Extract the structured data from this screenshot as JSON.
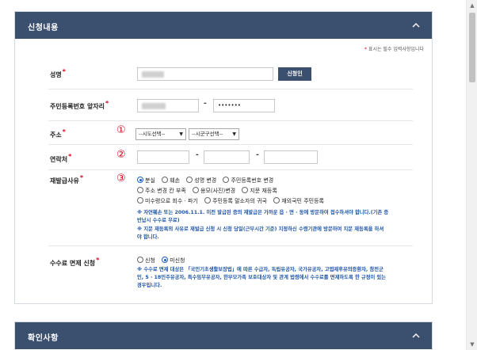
{
  "section1": {
    "title": "신청내용",
    "required_note": "표시는 필수 입력사항입니다",
    "required_mark": "*"
  },
  "fields": {
    "name": {
      "label": "성명",
      "button": "신청인"
    },
    "rrn": {
      "label": "주민등록번호 앞자리",
      "separator": "-",
      "back_value": "•••••••"
    },
    "address": {
      "label": "주소",
      "marker": "①",
      "sido": "--시도선택--",
      "sigungu": "--시군구선택--"
    },
    "contact": {
      "label": "연락처",
      "marker": "②",
      "sep1": "-",
      "sep2": "-"
    },
    "reason": {
      "label": "재발급사유",
      "marker": "③",
      "options_row1": [
        "분실",
        "훼손",
        "성명 변경",
        "주민등록번호 변경"
      ],
      "options_row2": [
        "주소 변경 칸 부족",
        "용모(사진)변경",
        "지문 재등록"
      ],
      "options_row3": [
        "미수령으로 회수 · 파기",
        "주민등록 말소자의 귀국",
        "재외국민 주민등록"
      ],
      "selected": "분실",
      "notice1_line1": "※ 자연훼손 또는 2006.11.1. 이전 발급된 증의 재발급은 가까운 읍 · 면 · 동에 방문하여 접수하셔야 합니다.(기존 증",
      "notice1_line2": "반납시 수수료 무료)",
      "notice2_line1": "※ 지문 재등록의 사유로 재발급 신청 시 신청 당일(근무시간 기준) 지정하신 수령기관에 방문하여 지문 재등록을 하셔",
      "notice2_line2": "야 합니다."
    },
    "fee": {
      "label": "수수료 면제 신청",
      "options": [
        "신청",
        "미신청"
      ],
      "selected": "미신청",
      "notice_line1": "※ 수수료 면제 대상은 「국민기초생활보장법」에 따른 수급자, 독립유공자, 국가유공자, 고엽제후유의증환자, 참전군",
      "notice_line2": "인, 5 · 18민주유공자, 특수임무유공자, 한부모가족 보호대상자 및 관계 법령에서 수수료를 면제하도록 한 규정이 있는",
      "notice_line3": "경우입니다."
    }
  },
  "section2": {
    "title": "확인사항"
  },
  "icons": {
    "collapse": "chevron-up-icon",
    "scroll_up": "arrow-up-icon",
    "scroll_down": "arrow-down-icon"
  },
  "colors": {
    "header": "#3b4f6e",
    "accent_red": "#d6001c",
    "notice_blue": "#1f56a8"
  }
}
